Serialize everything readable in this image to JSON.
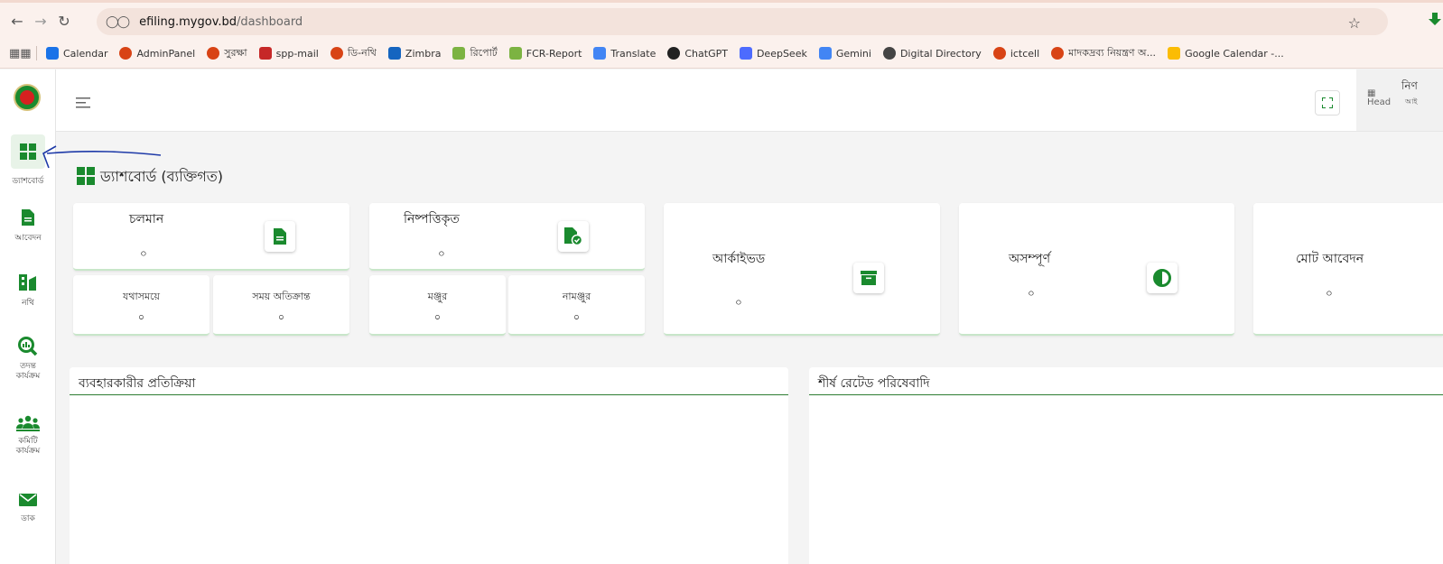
{
  "browser": {
    "url_host": "efiling.mygov.bd",
    "url_path": "/dashboard",
    "bookmarks": [
      {
        "label": "Calendar",
        "icon": "calendar-icon",
        "color": "#1a73e8"
      },
      {
        "label": "AdminPanel",
        "icon": "emblem-icon",
        "color": "#d84315"
      },
      {
        "label": "সুরক্ষা",
        "icon": "emblem-icon",
        "color": "#d84315"
      },
      {
        "label": "spp-mail",
        "icon": "n-logo-icon",
        "color": "#c62828"
      },
      {
        "label": "ডি-নথি",
        "icon": "emblem-icon",
        "color": "#d84315"
      },
      {
        "label": "Zimbra",
        "icon": "zimbra-icon",
        "color": "#1565c0"
      },
      {
        "label": "রিপোর্ট",
        "icon": "report-icon",
        "color": "#7cb342"
      },
      {
        "label": "FCR-Report",
        "icon": "report-icon",
        "color": "#7cb342"
      },
      {
        "label": "Translate",
        "icon": "translate-icon",
        "color": "#4285f4"
      },
      {
        "label": "ChatGPT",
        "icon": "chatgpt-icon",
        "color": "#222222"
      },
      {
        "label": "DeepSeek",
        "icon": "deepseek-icon",
        "color": "#4d6bfe"
      },
      {
        "label": "Gemini",
        "icon": "gemini-icon",
        "color": "#4285f4"
      },
      {
        "label": "Digital Directory",
        "icon": "globe-icon",
        "color": "#444444"
      },
      {
        "label": "ictcell",
        "icon": "emblem-icon",
        "color": "#d84315"
      },
      {
        "label": "মাদকদ্রব্য নিয়ন্ত্রণ অ...",
        "icon": "emblem-icon",
        "color": "#d84315"
      },
      {
        "label": "Google Calendar -...",
        "icon": "calendar-icon",
        "color": "#fbbc04"
      }
    ]
  },
  "theme": {
    "accent": "#1a8a2e",
    "accent_light": "#c8e6c9",
    "panel_rule": "#2e7d32"
  },
  "sidebar": {
    "items": [
      {
        "label": "ড্যাশবোর্ড",
        "icon": "dashboard-grid-icon",
        "active": true
      },
      {
        "label": "আবেদন",
        "icon": "document-icon"
      },
      {
        "label": "নথি",
        "icon": "files-icon"
      },
      {
        "label": "তদন্ত কার্যক্রম",
        "icon": "investigation-search-icon"
      },
      {
        "label": "কমিটি কার্যক্রম",
        "icon": "committee-group-icon"
      },
      {
        "label": "ডাক",
        "icon": "mail-envelope-icon"
      }
    ]
  },
  "header": {
    "user_name": "নিণ",
    "user_sub": "আই",
    "avatar_alt": "Head"
  },
  "page": {
    "title": "ড্যাশবোর্ড (ব্যক্তিগত)"
  },
  "cards": {
    "running": {
      "label": "চলমান",
      "value": "০"
    },
    "on_time": {
      "label": "যথাসময়ে",
      "value": "০"
    },
    "overdue": {
      "label": "সময় অতিক্রান্ত",
      "value": "০"
    },
    "resolved": {
      "label": "নিষ্পত্তিকৃত",
      "value": "০"
    },
    "approved": {
      "label": "মঞ্জুর",
      "value": "০"
    },
    "rejected": {
      "label": "নামঞ্জুর",
      "value": "০"
    },
    "archived": {
      "label": "আর্কাইভড",
      "value": "০"
    },
    "incomplete": {
      "label": "অসম্পূর্ণ",
      "value": "০"
    },
    "total": {
      "label": "মোট আবেদন",
      "value": "০"
    }
  },
  "panels": {
    "user_feedback": "ব্যবহারকারীর প্রতিক্রিয়া",
    "top_rated": "শীর্ষ রেটেড পরিষেবাদি"
  }
}
